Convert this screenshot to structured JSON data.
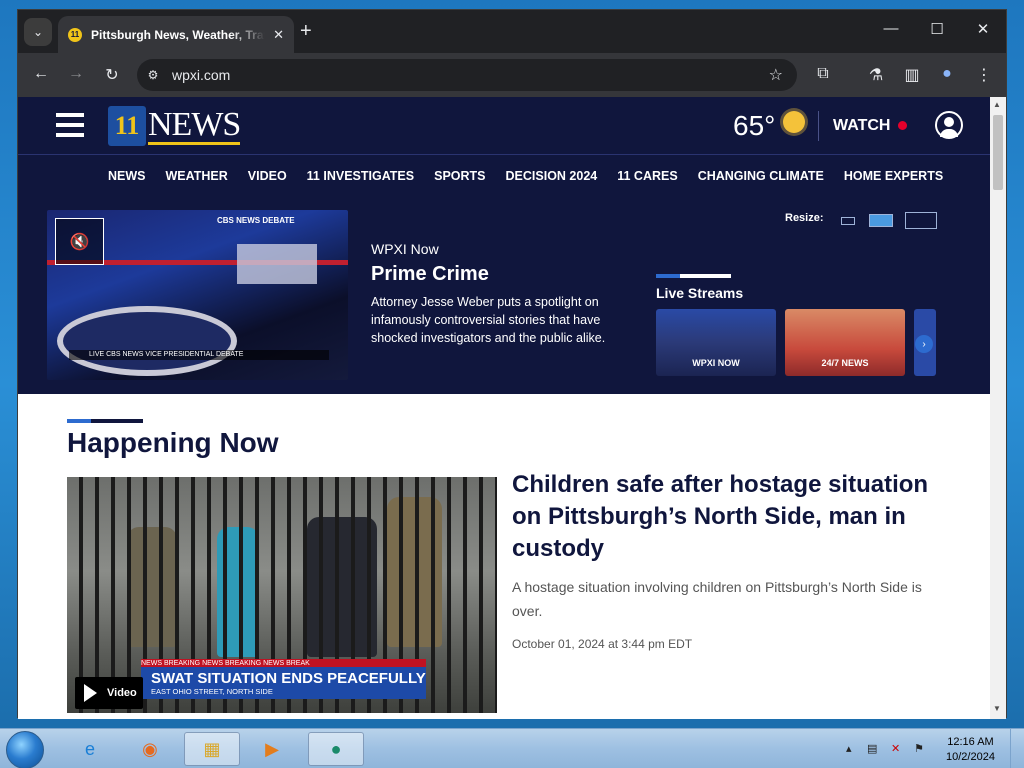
{
  "browser": {
    "tab_title": "Pittsburgh News, Weather, Traffic",
    "tab_close": "✕",
    "new_tab": "+",
    "url": "wpxi.com",
    "window_controls": {
      "minimize": "—",
      "maximize": "☐",
      "close": "✕"
    }
  },
  "site": {
    "logo_text": "NEWS",
    "logo_badge": "11",
    "temperature": "65°",
    "watch_label": "WATCH",
    "nav": [
      "NEWS",
      "WEATHER",
      "VIDEO",
      "11 INVESTIGATES",
      "SPORTS",
      "DECISION 2024",
      "11 CARES",
      "CHANGING CLIMATE",
      "HOME EXPERTS"
    ],
    "promo": {
      "kicker": "WPXI Now",
      "title": "Prime Crime",
      "description": "Attorney Jesse Weber puts a spotlight on infamously controversial stories that have shocked investigators and the public alike.",
      "video_ticker": "LIVE  CBS NEWS  VICE PRESIDENTIAL DEBATE",
      "video_overlay": "CBS NEWS DEBATE"
    },
    "resize_label": "Resize:",
    "live_streams": {
      "title": "Live Streams",
      "items": [
        {
          "label": "WPXI NOW"
        },
        {
          "label": "24/7 NEWS"
        }
      ]
    },
    "happening_now": {
      "title": "Happening Now",
      "story": {
        "headline": "Children safe after hostage situation on Pittsburgh’s North Side, man in custody",
        "summary": "A hostage situation involving children on Pittsburgh’s North Side is over.",
        "timestamp": "October 01, 2024 at 3:44 pm EDT",
        "video_label": "Video",
        "image_breaking": "NEWS  BREAKING NEWS  BREAKING NEWS  BREAK",
        "image_headline": "SWAT SITUATION ENDS PEACEFULLY",
        "image_sub": "EAST OHIO STREET, NORTH SIDE"
      }
    }
  },
  "taskbar": {
    "time": "12:16 AM",
    "date": "10/2/2024"
  },
  "colors": {
    "navy": "#10163d",
    "accent_blue": "#2d6bcf",
    "live_red": "#e4002b",
    "gold": "#f0c419"
  }
}
